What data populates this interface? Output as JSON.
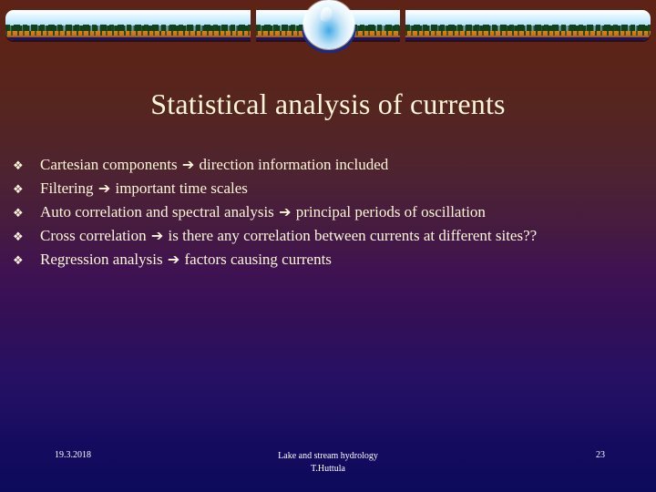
{
  "slide": {
    "title": "Statistical analysis of currents",
    "bullet_marker": "❖",
    "arrow": "➔",
    "bullets": [
      {
        "before": "Cartesian components",
        "after": "direction information included"
      },
      {
        "before": "Filtering",
        "after": "important time scales"
      },
      {
        "before": "Auto correlation and spectral analysis",
        "after": "principal periods of oscillation"
      },
      {
        "before": "Cross correlation",
        "after": "is there any  correlation between currents at different sites??"
      },
      {
        "before": "Regression analysis",
        "after": "factors causing currents"
      }
    ],
    "footer": {
      "date": "19.3.2018",
      "center_line1": "Lake and stream hydrology",
      "center_line2": "T.Huttula",
      "page_number": "23"
    },
    "colors": {
      "text": "#fdf6d8",
      "background_top": "#5d2317",
      "background_mid": "#3f1252",
      "background_bottom": "#0d0a5c",
      "footer_text": "#ffffff",
      "banner_sky": "#a8ddf7",
      "banner_ground": "#c4761a",
      "banner_vegetation": "#12401a"
    }
  }
}
